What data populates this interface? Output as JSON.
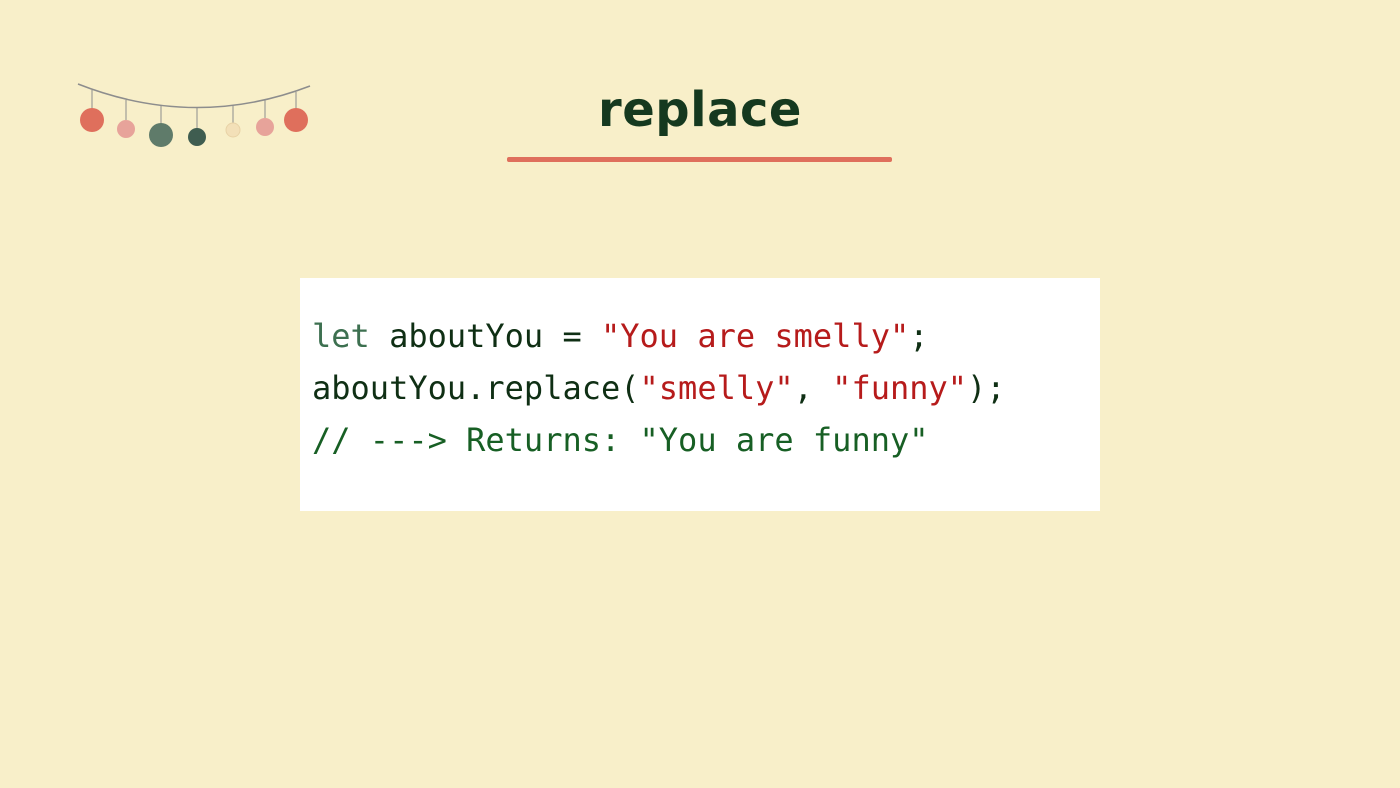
{
  "title": "replace",
  "decoration": {
    "name": "ornament-garland",
    "colors": {
      "string": "#8d8d8d",
      "red": "#df6f5c",
      "pink": "#e7a39a",
      "green": "#5f7b6a",
      "dark_green": "#3f5d50",
      "pale": "#f3e0b8"
    }
  },
  "colors": {
    "background": "#f8efc9",
    "title": "#15391f",
    "accent_underline": "#df6f5c",
    "code_background": "#ffffff",
    "code_text": "#0f2f14",
    "code_keyword": "#3d7050",
    "code_string": "#b61b1b",
    "code_comment": "#175f24"
  },
  "code": {
    "line1": {
      "keyword": "let",
      "text_before": " aboutYou = ",
      "string": "\"You are smelly\"",
      "text_after": ";"
    },
    "line2": {
      "text_before": "aboutYou.replace(",
      "string1": "\"smelly\"",
      "separator": ", ",
      "string2": "\"funny\"",
      "text_after": ");"
    },
    "line3": {
      "comment": "// ---> Returns: \"You are funny\""
    }
  }
}
